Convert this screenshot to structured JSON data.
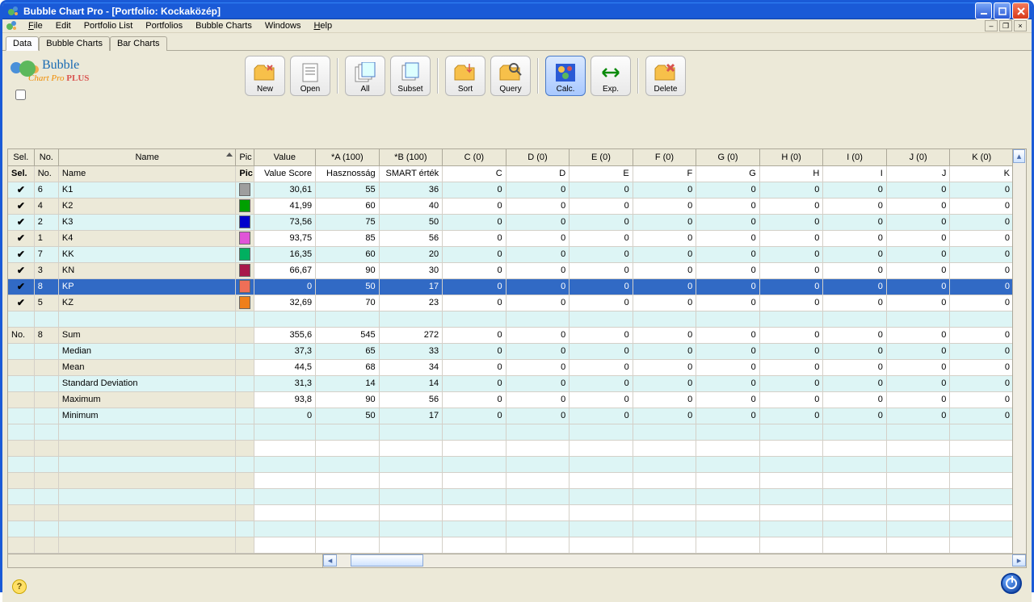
{
  "title": "Bubble Chart Pro  -  [Portfolio: Kockaközép]",
  "menu": {
    "file": "File",
    "edit": "Edit",
    "portfolioList": "Portfolio List",
    "portfolios": "Portfolios",
    "bubbleCharts": "Bubble Charts",
    "windows": "Windows",
    "help": "Help"
  },
  "tabs": {
    "data": "Data",
    "bubble": "Bubble Charts",
    "bar": "Bar Charts"
  },
  "logo": {
    "line1": "Bubble",
    "line2a": "Chart Pro ",
    "line2b": "PLUS"
  },
  "toolbar": {
    "new": "New",
    "open": "Open",
    "all": "All",
    "subset": "Subset",
    "sort": "Sort",
    "query": "Query",
    "calc": "Calc.",
    "exp": "Exp.",
    "delete": "Delete"
  },
  "columns": {
    "sel": "Sel.",
    "no": "No.",
    "name": "Name",
    "pic": "Pic",
    "value": "Value",
    "a": "*A (100)",
    "b": "*B (100)",
    "c": "C (0)",
    "d": "D (0)",
    "e": "E (0)",
    "f": "F (0)",
    "g": "G (0)",
    "h": "H (0)",
    "i": "I (0)",
    "j": "J (0)",
    "k": "K (0)"
  },
  "subheader": {
    "sel": "Sel.",
    "no": "No.",
    "name": "Name",
    "pic": "Pic",
    "value": "Value Score",
    "a": "Hasznosság",
    "b": "SMART érték",
    "c": "C",
    "d": "D",
    "e": "E",
    "f": "F",
    "g": "G",
    "h": "H",
    "i": "I",
    "j": "J",
    "k": "K"
  },
  "rows": [
    {
      "sel": true,
      "no": "6",
      "name": "K1",
      "color": "#9e9e9e",
      "value": "30,61",
      "a": "55",
      "b": "36",
      "c": "0",
      "d": "0",
      "e": "0",
      "f": "0",
      "g": "0",
      "h": "0",
      "i": "0",
      "j": "0",
      "k": "0"
    },
    {
      "sel": true,
      "no": "4",
      "name": "K2",
      "color": "#00a000",
      "value": "41,99",
      "a": "60",
      "b": "40",
      "c": "0",
      "d": "0",
      "e": "0",
      "f": "0",
      "g": "0",
      "h": "0",
      "i": "0",
      "j": "0",
      "k": "0"
    },
    {
      "sel": true,
      "no": "2",
      "name": "K3",
      "color": "#0000cc",
      "value": "73,56",
      "a": "75",
      "b": "50",
      "c": "0",
      "d": "0",
      "e": "0",
      "f": "0",
      "g": "0",
      "h": "0",
      "i": "0",
      "j": "0",
      "k": "0"
    },
    {
      "sel": true,
      "no": "1",
      "name": "K4",
      "color": "#e055d8",
      "value": "93,75",
      "a": "85",
      "b": "56",
      "c": "0",
      "d": "0",
      "e": "0",
      "f": "0",
      "g": "0",
      "h": "0",
      "i": "0",
      "j": "0",
      "k": "0"
    },
    {
      "sel": true,
      "no": "7",
      "name": "KK",
      "color": "#00b060",
      "value": "16,35",
      "a": "60",
      "b": "20",
      "c": "0",
      "d": "0",
      "e": "0",
      "f": "0",
      "g": "0",
      "h": "0",
      "i": "0",
      "j": "0",
      "k": "0"
    },
    {
      "sel": true,
      "no": "3",
      "name": "KN",
      "color": "#a8184a",
      "value": "66,67",
      "a": "90",
      "b": "30",
      "c": "0",
      "d": "0",
      "e": "0",
      "f": "0",
      "g": "0",
      "h": "0",
      "i": "0",
      "j": "0",
      "k": "0"
    },
    {
      "sel": true,
      "no": "8",
      "name": "KP",
      "color": "#ef6f57",
      "value": "0",
      "a": "50",
      "b": "17",
      "c": "0",
      "d": "0",
      "e": "0",
      "f": "0",
      "g": "0",
      "h": "0",
      "i": "0",
      "j": "0",
      "k": "0",
      "selected": true
    },
    {
      "sel": true,
      "no": "5",
      "name": "KZ",
      "color": "#ef7f1a",
      "value": "32,69",
      "a": "70",
      "b": "23",
      "c": "0",
      "d": "0",
      "e": "0",
      "f": "0",
      "g": "0",
      "h": "0",
      "i": "0",
      "j": "0",
      "k": "0"
    }
  ],
  "summary": {
    "count": "8",
    "rows": [
      {
        "name": "Sum",
        "value": "355,6",
        "a": "545",
        "b": "272",
        "c": "0",
        "d": "0",
        "e": "0",
        "f": "0",
        "g": "0",
        "h": "0",
        "i": "0",
        "j": "0",
        "k": "0"
      },
      {
        "name": "Median",
        "value": "37,3",
        "a": "65",
        "b": "33",
        "c": "0",
        "d": "0",
        "e": "0",
        "f": "0",
        "g": "0",
        "h": "0",
        "i": "0",
        "j": "0",
        "k": "0"
      },
      {
        "name": "Mean",
        "value": "44,5",
        "a": "68",
        "b": "34",
        "c": "0",
        "d": "0",
        "e": "0",
        "f": "0",
        "g": "0",
        "h": "0",
        "i": "0",
        "j": "0",
        "k": "0"
      },
      {
        "name": "Standard Deviation",
        "value": "31,3",
        "a": "14",
        "b": "14",
        "c": "0",
        "d": "0",
        "e": "0",
        "f": "0",
        "g": "0",
        "h": "0",
        "i": "0",
        "j": "0",
        "k": "0"
      },
      {
        "name": "Maximum",
        "value": "93,8",
        "a": "90",
        "b": "56",
        "c": "0",
        "d": "0",
        "e": "0",
        "f": "0",
        "g": "0",
        "h": "0",
        "i": "0",
        "j": "0",
        "k": "0"
      },
      {
        "name": "Minimum",
        "value": "0",
        "a": "50",
        "b": "17",
        "c": "0",
        "d": "0",
        "e": "0",
        "f": "0",
        "g": "0",
        "h": "0",
        "i": "0",
        "j": "0",
        "k": "0"
      }
    ]
  },
  "summaryLabel": "No.",
  "colors": {
    "titlebar": "#1a5ad7",
    "accent": "#316ac5",
    "altRow": "#ddf5f5",
    "chromeBg": "#ece9d8"
  },
  "chart_data": {
    "type": "table",
    "columns": [
      "No.",
      "Name",
      "Value Score",
      "Hasznosság",
      "SMART érték",
      "C",
      "D",
      "E",
      "F",
      "G",
      "H",
      "I",
      "J",
      "K"
    ],
    "rows": [
      [
        6,
        "K1",
        30.61,
        55,
        36,
        0,
        0,
        0,
        0,
        0,
        0,
        0,
        0,
        0
      ],
      [
        4,
        "K2",
        41.99,
        60,
        40,
        0,
        0,
        0,
        0,
        0,
        0,
        0,
        0,
        0
      ],
      [
        2,
        "K3",
        73.56,
        75,
        50,
        0,
        0,
        0,
        0,
        0,
        0,
        0,
        0,
        0
      ],
      [
        1,
        "K4",
        93.75,
        85,
        56,
        0,
        0,
        0,
        0,
        0,
        0,
        0,
        0,
        0
      ],
      [
        7,
        "KK",
        16.35,
        60,
        20,
        0,
        0,
        0,
        0,
        0,
        0,
        0,
        0,
        0
      ],
      [
        3,
        "KN",
        66.67,
        90,
        30,
        0,
        0,
        0,
        0,
        0,
        0,
        0,
        0,
        0
      ],
      [
        8,
        "KP",
        0,
        50,
        17,
        0,
        0,
        0,
        0,
        0,
        0,
        0,
        0,
        0
      ],
      [
        5,
        "KZ",
        32.69,
        70,
        23,
        0,
        0,
        0,
        0,
        0,
        0,
        0,
        0,
        0
      ]
    ],
    "summary": {
      "Sum": [
        355.6,
        545,
        272,
        0,
        0,
        0,
        0,
        0,
        0,
        0,
        0,
        0
      ],
      "Median": [
        37.3,
        65,
        33,
        0,
        0,
        0,
        0,
        0,
        0,
        0,
        0,
        0
      ],
      "Mean": [
        44.5,
        68,
        34,
        0,
        0,
        0,
        0,
        0,
        0,
        0,
        0,
        0
      ],
      "Standard Deviation": [
        31.3,
        14,
        14,
        0,
        0,
        0,
        0,
        0,
        0,
        0,
        0,
        0
      ],
      "Maximum": [
        93.8,
        90,
        56,
        0,
        0,
        0,
        0,
        0,
        0,
        0,
        0,
        0
      ],
      "Minimum": [
        0,
        50,
        17,
        0,
        0,
        0,
        0,
        0,
        0,
        0,
        0,
        0
      ]
    }
  }
}
